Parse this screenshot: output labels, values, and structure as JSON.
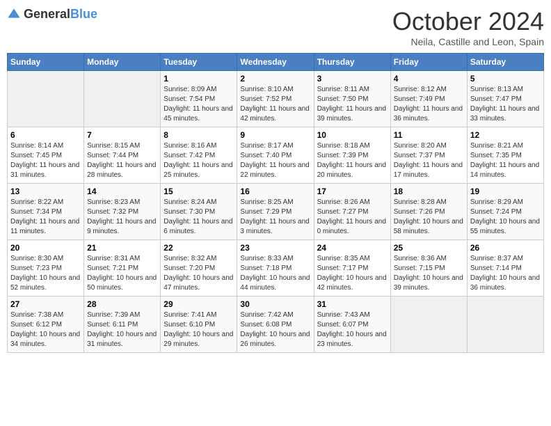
{
  "logo": {
    "text_general": "General",
    "text_blue": "Blue"
  },
  "header": {
    "month": "October 2024",
    "location": "Neila, Castille and Leon, Spain"
  },
  "weekdays": [
    "Sunday",
    "Monday",
    "Tuesday",
    "Wednesday",
    "Thursday",
    "Friday",
    "Saturday"
  ],
  "weeks": [
    [
      {
        "day": "",
        "empty": true
      },
      {
        "day": "",
        "empty": true
      },
      {
        "day": "1",
        "sunrise": "8:09 AM",
        "sunset": "7:54 PM",
        "daylight": "11 hours and 45 minutes."
      },
      {
        "day": "2",
        "sunrise": "8:10 AM",
        "sunset": "7:52 PM",
        "daylight": "11 hours and 42 minutes."
      },
      {
        "day": "3",
        "sunrise": "8:11 AM",
        "sunset": "7:50 PM",
        "daylight": "11 hours and 39 minutes."
      },
      {
        "day": "4",
        "sunrise": "8:12 AM",
        "sunset": "7:49 PM",
        "daylight": "11 hours and 36 minutes."
      },
      {
        "day": "5",
        "sunrise": "8:13 AM",
        "sunset": "7:47 PM",
        "daylight": "11 hours and 33 minutes."
      }
    ],
    [
      {
        "day": "6",
        "sunrise": "8:14 AM",
        "sunset": "7:45 PM",
        "daylight": "11 hours and 31 minutes."
      },
      {
        "day": "7",
        "sunrise": "8:15 AM",
        "sunset": "7:44 PM",
        "daylight": "11 hours and 28 minutes."
      },
      {
        "day": "8",
        "sunrise": "8:16 AM",
        "sunset": "7:42 PM",
        "daylight": "11 hours and 25 minutes."
      },
      {
        "day": "9",
        "sunrise": "8:17 AM",
        "sunset": "7:40 PM",
        "daylight": "11 hours and 22 minutes."
      },
      {
        "day": "10",
        "sunrise": "8:18 AM",
        "sunset": "7:39 PM",
        "daylight": "11 hours and 20 minutes."
      },
      {
        "day": "11",
        "sunrise": "8:20 AM",
        "sunset": "7:37 PM",
        "daylight": "11 hours and 17 minutes."
      },
      {
        "day": "12",
        "sunrise": "8:21 AM",
        "sunset": "7:35 PM",
        "daylight": "11 hours and 14 minutes."
      }
    ],
    [
      {
        "day": "13",
        "sunrise": "8:22 AM",
        "sunset": "7:34 PM",
        "daylight": "11 hours and 11 minutes."
      },
      {
        "day": "14",
        "sunrise": "8:23 AM",
        "sunset": "7:32 PM",
        "daylight": "11 hours and 9 minutes."
      },
      {
        "day": "15",
        "sunrise": "8:24 AM",
        "sunset": "7:30 PM",
        "daylight": "11 hours and 6 minutes."
      },
      {
        "day": "16",
        "sunrise": "8:25 AM",
        "sunset": "7:29 PM",
        "daylight": "11 hours and 3 minutes."
      },
      {
        "day": "17",
        "sunrise": "8:26 AM",
        "sunset": "7:27 PM",
        "daylight": "11 hours and 0 minutes."
      },
      {
        "day": "18",
        "sunrise": "8:28 AM",
        "sunset": "7:26 PM",
        "daylight": "10 hours and 58 minutes."
      },
      {
        "day": "19",
        "sunrise": "8:29 AM",
        "sunset": "7:24 PM",
        "daylight": "10 hours and 55 minutes."
      }
    ],
    [
      {
        "day": "20",
        "sunrise": "8:30 AM",
        "sunset": "7:23 PM",
        "daylight": "10 hours and 52 minutes."
      },
      {
        "day": "21",
        "sunrise": "8:31 AM",
        "sunset": "7:21 PM",
        "daylight": "10 hours and 50 minutes."
      },
      {
        "day": "22",
        "sunrise": "8:32 AM",
        "sunset": "7:20 PM",
        "daylight": "10 hours and 47 minutes."
      },
      {
        "day": "23",
        "sunrise": "8:33 AM",
        "sunset": "7:18 PM",
        "daylight": "10 hours and 44 minutes."
      },
      {
        "day": "24",
        "sunrise": "8:35 AM",
        "sunset": "7:17 PM",
        "daylight": "10 hours and 42 minutes."
      },
      {
        "day": "25",
        "sunrise": "8:36 AM",
        "sunset": "7:15 PM",
        "daylight": "10 hours and 39 minutes."
      },
      {
        "day": "26",
        "sunrise": "8:37 AM",
        "sunset": "7:14 PM",
        "daylight": "10 hours and 36 minutes."
      }
    ],
    [
      {
        "day": "27",
        "sunrise": "7:38 AM",
        "sunset": "6:12 PM",
        "daylight": "10 hours and 34 minutes."
      },
      {
        "day": "28",
        "sunrise": "7:39 AM",
        "sunset": "6:11 PM",
        "daylight": "10 hours and 31 minutes."
      },
      {
        "day": "29",
        "sunrise": "7:41 AM",
        "sunset": "6:10 PM",
        "daylight": "10 hours and 29 minutes."
      },
      {
        "day": "30",
        "sunrise": "7:42 AM",
        "sunset": "6:08 PM",
        "daylight": "10 hours and 26 minutes."
      },
      {
        "day": "31",
        "sunrise": "7:43 AM",
        "sunset": "6:07 PM",
        "daylight": "10 hours and 23 minutes."
      },
      {
        "day": "",
        "empty": true
      },
      {
        "day": "",
        "empty": true
      }
    ]
  ]
}
